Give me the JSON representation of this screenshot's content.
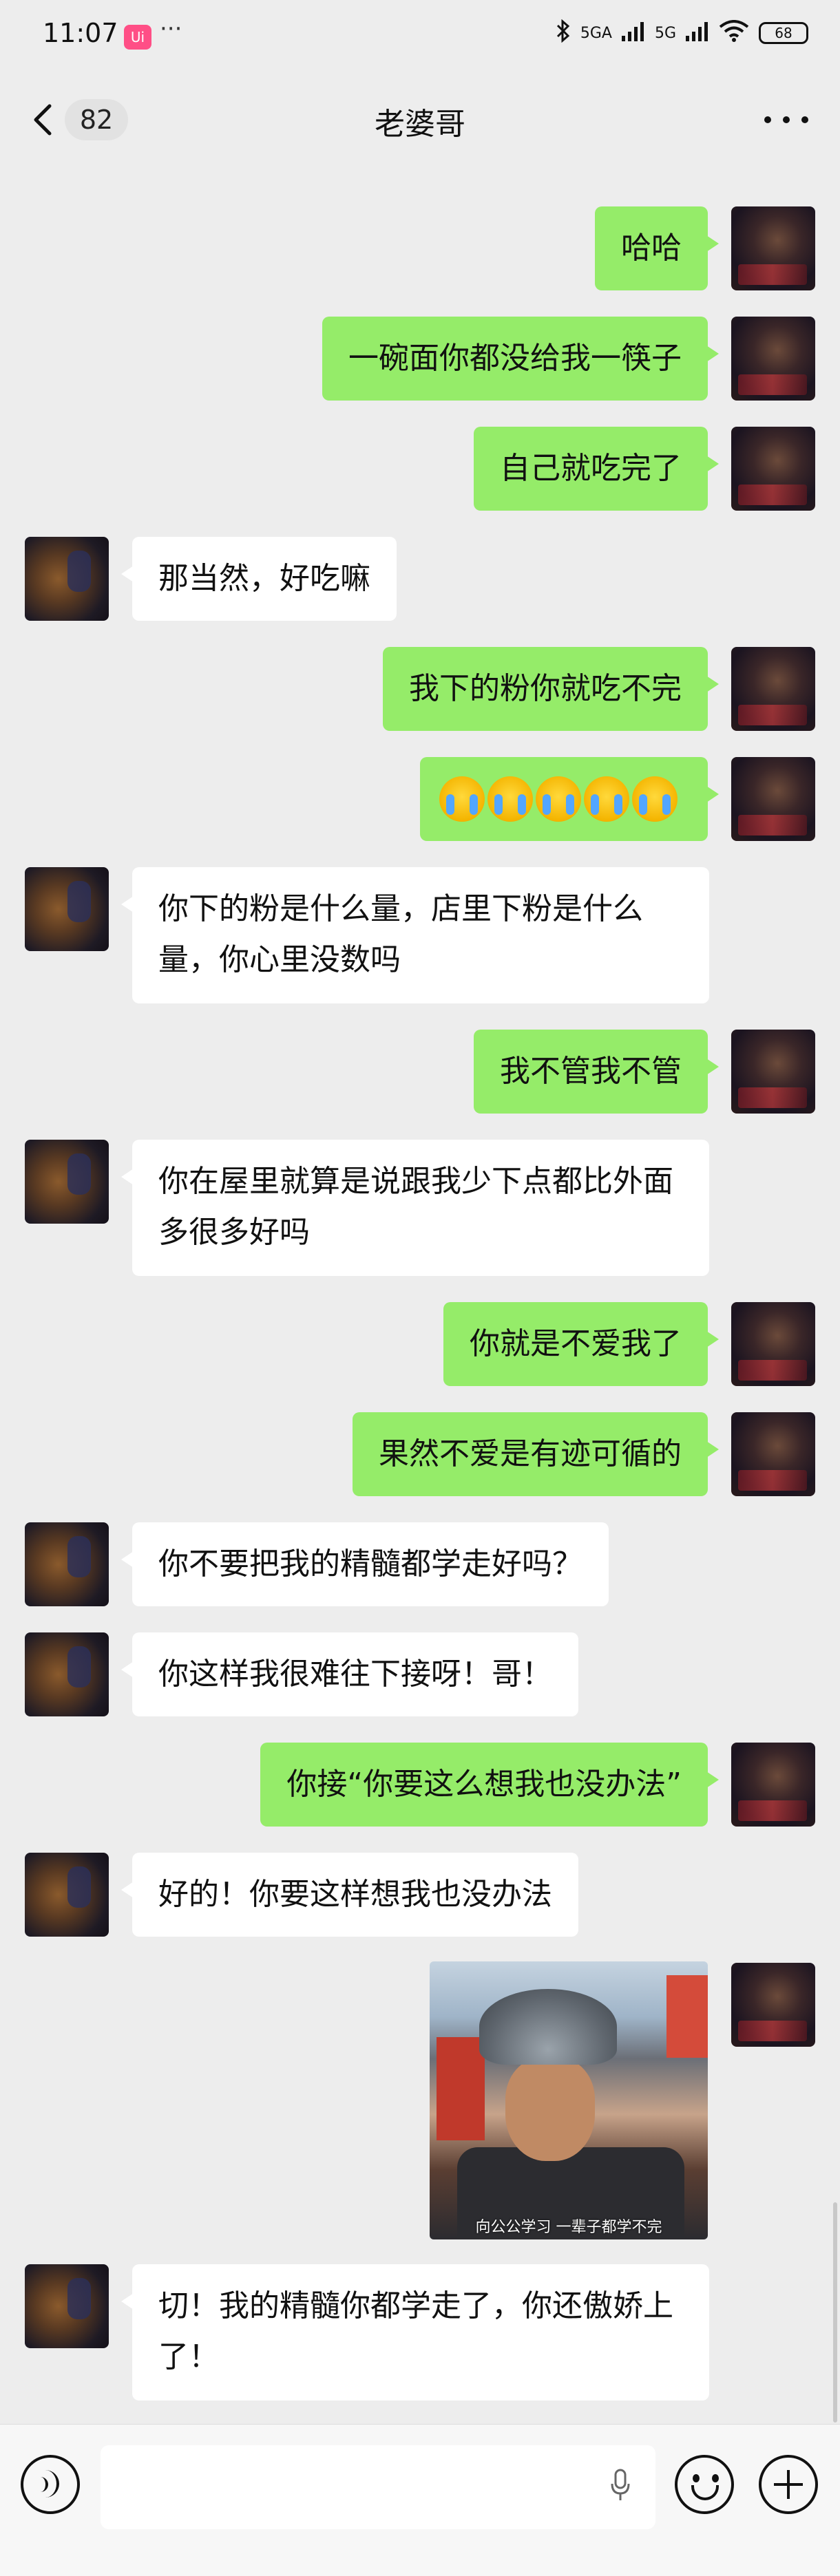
{
  "status_bar": {
    "time": "11:07",
    "app_badge": "Ui",
    "more": "···",
    "signal1": "5GA",
    "signal2": "5G",
    "battery": "68"
  },
  "header": {
    "back_count": "82",
    "title": "老婆哥"
  },
  "messages": [
    {
      "side": "right",
      "text": "哈哈"
    },
    {
      "side": "right",
      "text": "一碗面你都没给我一筷子"
    },
    {
      "side": "right",
      "text": "自己就吃完了"
    },
    {
      "side": "left",
      "text": "那当然，好吃嘛"
    },
    {
      "side": "right",
      "text": "我下的粉你就吃不完"
    },
    {
      "side": "right",
      "text": "😭😭😭😭😭"
    },
    {
      "side": "left",
      "text": "你下的粉是什么量，店里下粉是什么量，你心里没数吗"
    },
    {
      "side": "right",
      "text": "我不管我不管"
    },
    {
      "side": "left",
      "text": "你在屋里就算是说跟我少下点都比外面多很多好吗"
    },
    {
      "side": "right",
      "text": "你就是不爱我了"
    },
    {
      "side": "right",
      "text": "果然不爱是有迹可循的"
    },
    {
      "side": "left",
      "text": "你不要把我的精髓都学走好吗？"
    },
    {
      "side": "left",
      "text": "你这样我很难往下接呀！哥！"
    },
    {
      "side": "right",
      "text": "你接“你要这么想我也没办法”"
    },
    {
      "side": "left",
      "text": "好的！你要这样想我也没办法"
    },
    {
      "side": "right",
      "type": "image",
      "caption": "向公公学习 一辈子都学不完"
    },
    {
      "side": "left",
      "text": "切！我的精髓你都学走了，你还傲娇上了！"
    }
  ],
  "colors": {
    "background": "#ededed",
    "bubble_self": "#95ec69",
    "bubble_other": "#ffffff"
  },
  "icons": {
    "back": "chevron-left-icon",
    "more": "more-dots-icon",
    "voice": "voice-icon",
    "mic": "mic-icon",
    "emoji": "emoji-icon",
    "plus": "plus-icon"
  }
}
